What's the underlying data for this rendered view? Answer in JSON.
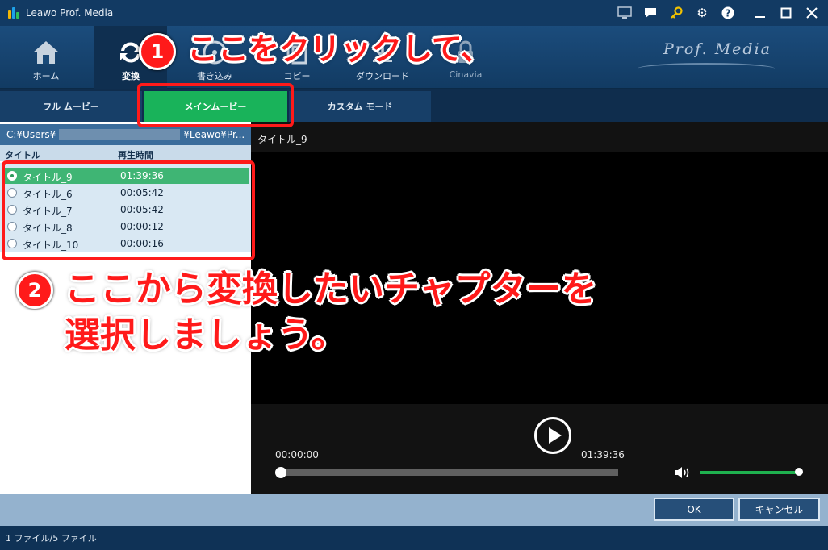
{
  "window": {
    "title": "Leawo Prof. Media",
    "logo_colors": [
      "#f2b705",
      "#1ea1e8",
      "#2fbf5a"
    ],
    "controls": [
      "monitor-icon",
      "chat-icon",
      "key-icon",
      "gear-icon",
      "help-icon",
      "minimize-icon",
      "maximize-icon",
      "close-icon"
    ]
  },
  "toolbar": {
    "items": [
      {
        "label": "ホーム",
        "icon": "home-icon"
      },
      {
        "label": "変換",
        "icon": "convert-icon",
        "active": true
      },
      {
        "label": "書き込み",
        "icon": "burn-icon"
      },
      {
        "label": "コピー",
        "icon": "copy-icon"
      },
      {
        "label": "ダウンロード",
        "icon": "download-icon"
      },
      {
        "label": "Cinavia",
        "icon": "cinavia-lock-icon"
      }
    ],
    "brand": "Prof. Media"
  },
  "mode_tabs": {
    "full": "フル ムービー",
    "main": "メインムービー",
    "custom": "カスタム モード",
    "active": "main"
  },
  "source": {
    "path_prefix": "C:¥Users¥",
    "path_suffix": "¥Leawo¥Pr..."
  },
  "titles_list": {
    "header_title": "タイトル",
    "header_duration": "再生時間",
    "rows": [
      {
        "title": "タイトル_9",
        "duration": "01:39:36",
        "selected": true
      },
      {
        "title": "タイトル_6",
        "duration": "00:05:42",
        "selected": false
      },
      {
        "title": "タイトル_7",
        "duration": "00:05:42",
        "selected": false
      },
      {
        "title": "タイトル_8",
        "duration": "00:00:12",
        "selected": false
      },
      {
        "title": "タイトル_10",
        "duration": "00:00:16",
        "selected": false
      }
    ]
  },
  "preview": {
    "title": "タイトル_9",
    "current_time": "00:00:00",
    "total_time": "01:39:36",
    "volume": 1.0,
    "progress": 0.0
  },
  "buttons": {
    "ok": "OK",
    "cancel": "キャンセル"
  },
  "status": "1 ファイル/5 ファイル",
  "annotations": {
    "step1_number": "1",
    "step1_text": "ここをクリックして、",
    "step2_number": "2",
    "step2_line1": "ここから変換したいチャプターを",
    "step2_line2": "選択しましょう。",
    "color": "#ff1a1a"
  }
}
